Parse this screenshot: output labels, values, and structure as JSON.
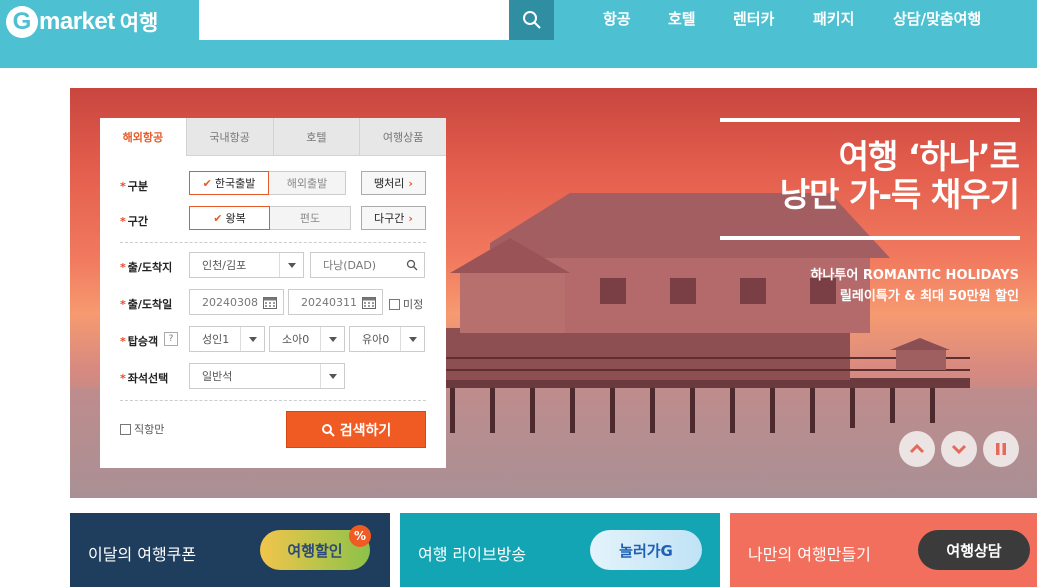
{
  "header": {
    "logo_g": "G",
    "logo_text": "market",
    "logo_sub": "여행",
    "search_placeholder": "",
    "nav": [
      "항공",
      "호텔",
      "렌터카",
      "패키지",
      "상담/맞춤여행"
    ]
  },
  "banner": {
    "title_line1": "여행 ‘하나’로",
    "title_line2": "낭만 가-득 채우기",
    "sub1": "하나투어 ROMANTIC HOLIDAYS",
    "sub2": "릴레이특가 & 최대 50만원 할인"
  },
  "booking": {
    "tabs": [
      "해외항공",
      "국내항공",
      "호텔",
      "여행상품"
    ],
    "active_tab": 0,
    "type": {
      "label": "구분",
      "options": [
        "한국출발",
        "해외출발"
      ],
      "selected": 0,
      "extra": "땡처리"
    },
    "route": {
      "label": "구간",
      "options": [
        "왕복",
        "편도"
      ],
      "selected": 0,
      "extra": "다구간"
    },
    "place": {
      "label": "출/도착지",
      "from": "인천/김포",
      "to": "다낭(DAD)"
    },
    "dates": {
      "label": "출/도착일",
      "depart": "20240308",
      "arrive": "20240311",
      "undecided": "미정"
    },
    "passengers": {
      "label": "탑승객",
      "help": "?",
      "adult": "성인1",
      "child": "소아0",
      "infant": "유아0"
    },
    "seat": {
      "label": "좌석선택",
      "value": "일반석"
    },
    "direct_only": "직항만",
    "search_button": "검색하기"
  },
  "cards": [
    {
      "text": "이달의 여행쿠폰",
      "badge": "여행할인",
      "bg": "#1f3d5c"
    },
    {
      "text": "여행 라이브방송",
      "badge": "놀러가G",
      "bg": "#14a5b5"
    },
    {
      "text": "나만의 여행만들기",
      "badge": "여행상담",
      "bg": "#f26f5d"
    }
  ],
  "colors": {
    "header": "#4dc0d1",
    "accent": "#f05a23"
  },
  "icons": {
    "search": "search-icon",
    "calendar": "calendar-icon",
    "up": "chevron-up-icon",
    "down": "chevron-down-icon",
    "pause": "pause-icon"
  }
}
